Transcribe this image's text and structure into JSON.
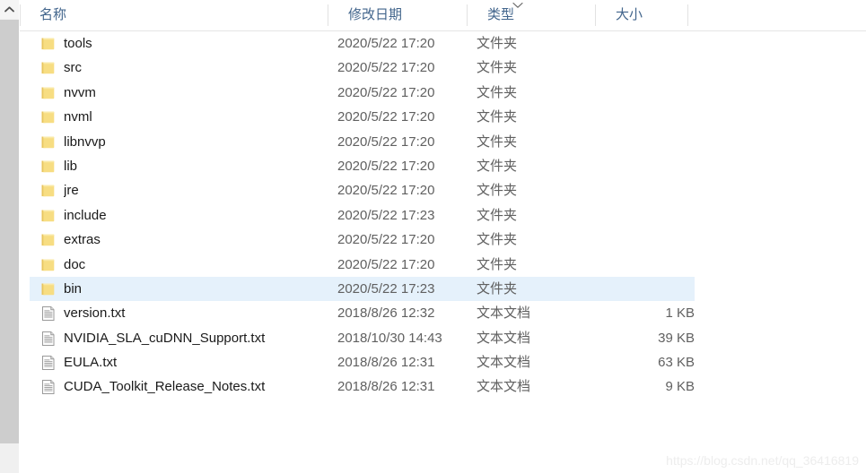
{
  "scrollbar": {
    "up_arrow_icon": "chevron-up-icon"
  },
  "columns": {
    "name": "名称",
    "date_modified": "修改日期",
    "type": "类型",
    "size": "大小",
    "sort_indicator_icon": "chevron-down-icon",
    "sorted_column": "类型",
    "sort_direction": "descending"
  },
  "selection_color": "#e5f1fb",
  "rows": [
    {
      "icon": "folder-icon",
      "name": "tools",
      "date": "2020/5/22 17:20",
      "type": "文件夹",
      "size": "",
      "selected": false
    },
    {
      "icon": "folder-icon",
      "name": "src",
      "date": "2020/5/22 17:20",
      "type": "文件夹",
      "size": "",
      "selected": false
    },
    {
      "icon": "folder-icon",
      "name": "nvvm",
      "date": "2020/5/22 17:20",
      "type": "文件夹",
      "size": "",
      "selected": false
    },
    {
      "icon": "folder-icon",
      "name": "nvml",
      "date": "2020/5/22 17:20",
      "type": "文件夹",
      "size": "",
      "selected": false
    },
    {
      "icon": "folder-icon",
      "name": "libnvvp",
      "date": "2020/5/22 17:20",
      "type": "文件夹",
      "size": "",
      "selected": false
    },
    {
      "icon": "folder-icon",
      "name": "lib",
      "date": "2020/5/22 17:20",
      "type": "文件夹",
      "size": "",
      "selected": false
    },
    {
      "icon": "folder-icon",
      "name": "jre",
      "date": "2020/5/22 17:20",
      "type": "文件夹",
      "size": "",
      "selected": false
    },
    {
      "icon": "folder-icon",
      "name": "include",
      "date": "2020/5/22 17:23",
      "type": "文件夹",
      "size": "",
      "selected": false
    },
    {
      "icon": "folder-icon",
      "name": "extras",
      "date": "2020/5/22 17:20",
      "type": "文件夹",
      "size": "",
      "selected": false
    },
    {
      "icon": "folder-icon",
      "name": "doc",
      "date": "2020/5/22 17:20",
      "type": "文件夹",
      "size": "",
      "selected": false
    },
    {
      "icon": "folder-icon",
      "name": "bin",
      "date": "2020/5/22 17:23",
      "type": "文件夹",
      "size": "",
      "selected": true
    },
    {
      "icon": "text-file-icon",
      "name": "version.txt",
      "date": "2018/8/26 12:32",
      "type": "文本文档",
      "size": "1 KB",
      "selected": false
    },
    {
      "icon": "text-file-icon",
      "name": "NVIDIA_SLA_cuDNN_Support.txt",
      "date": "2018/10/30 14:43",
      "type": "文本文档",
      "size": "39 KB",
      "selected": false
    },
    {
      "icon": "text-file-icon",
      "name": "EULA.txt",
      "date": "2018/8/26 12:31",
      "type": "文本文档",
      "size": "63 KB",
      "selected": false
    },
    {
      "icon": "text-file-icon",
      "name": "CUDA_Toolkit_Release_Notes.txt",
      "date": "2018/8/26 12:31",
      "type": "文本文档",
      "size": "9 KB",
      "selected": false
    }
  ],
  "watermark": "https://blog.csdn.net/qq_36416819"
}
